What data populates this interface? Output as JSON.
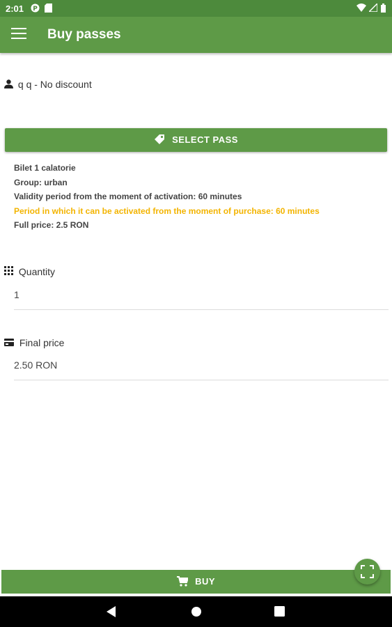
{
  "status_bar": {
    "time": "2:01"
  },
  "app_bar": {
    "title": "Buy passes"
  },
  "user": {
    "label": "q q - No discount"
  },
  "select_pass": {
    "label": "SELECT PASS"
  },
  "pass": {
    "name": "Bilet 1 calatorie",
    "group": "Group: urban",
    "validity": "Validity period from the moment of activation: 60 minutes",
    "activation": "Period in which it can be activated from the moment of purchase: 60 minutes",
    "price": "Full price: 2.5 RON"
  },
  "quantity": {
    "label": "Quantity",
    "value": "1"
  },
  "final_price": {
    "label": "Final price",
    "value": "2.50 RON"
  },
  "buy": {
    "label": "BUY"
  },
  "colors": {
    "primary": "#5e9a47",
    "status_bar": "#4d8a3c",
    "warning": "#f3b400"
  },
  "icons": [
    "menu-icon",
    "person-icon",
    "tag-icon",
    "grid-icon",
    "credit-card-icon",
    "cart-icon",
    "fullscreen-icon",
    "back-icon",
    "home-icon",
    "recents-icon"
  ]
}
